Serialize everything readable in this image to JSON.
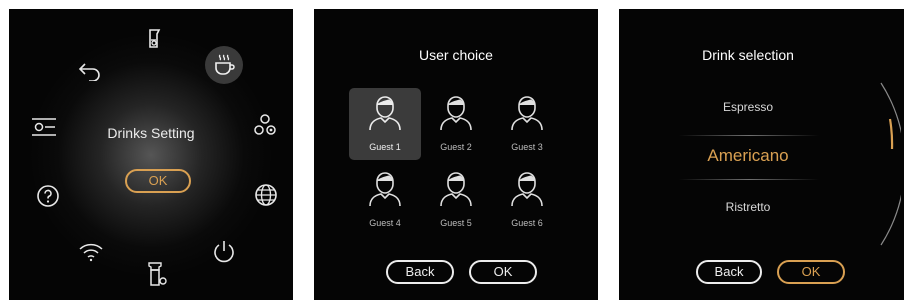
{
  "screens": {
    "drinks_setting": {
      "center_label": "Drinks Setting",
      "ok_label": "OK",
      "icons": [
        "back-arrow-icon",
        "milk-jug-icon",
        "coffee-cup-icon",
        "settings-slider-icon",
        "beans-icon",
        "help-icon",
        "globe-icon",
        "wifi-icon",
        "milk-container-icon",
        "power-icon"
      ],
      "selected_icon": "coffee-cup-icon"
    },
    "user_choice": {
      "title": "User choice",
      "guests": [
        {
          "label": "Guest 1",
          "selected": true
        },
        {
          "label": "Guest 2",
          "selected": false
        },
        {
          "label": "Guest 3",
          "selected": false
        },
        {
          "label": "Guest 4",
          "selected": false
        },
        {
          "label": "Guest 5",
          "selected": false
        },
        {
          "label": "Guest 6",
          "selected": false
        }
      ],
      "back_label": "Back",
      "ok_label": "OK"
    },
    "drink_selection": {
      "title": "Drink selection",
      "options": [
        "Espresso",
        "Americano",
        "Ristretto"
      ],
      "selected": "Americano",
      "back_label": "Back",
      "ok_label": "OK"
    }
  },
  "colors": {
    "accent": "#d9a052",
    "background": "#050505",
    "text": "#ececec"
  }
}
